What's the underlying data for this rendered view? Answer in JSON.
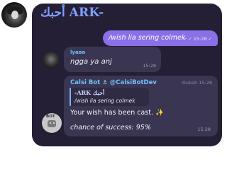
{
  "chat": {
    "title": "أحبك ARK-"
  },
  "messages": {
    "outgoing": {
      "text": "/wish lia sering colmek",
      "meta": "↩ ✓ 15:28 ✓"
    },
    "incoming": {
      "sender": "lyaaa",
      "text": "ngga ya anj",
      "time": "15:28"
    },
    "bot": {
      "sender_name": "Calsi Bot",
      "sender_icon": "anchor-icon",
      "sender_handle": "@CalsiBotDev",
      "edited_label": "diubah 15:28",
      "quote_title": "-ARK أحبك",
      "quote_text": "/wish lia sering colmek",
      "result": "Your wish has been cast.",
      "result_icon": "✨",
      "chance": "chance of success: 95%",
      "time": "15:28",
      "avatar_label": "BOT"
    }
  },
  "colors": {
    "card_bg": "#241f35",
    "outgoing_bubble": "#8b6fe6",
    "incoming_bubble": "#3a3550",
    "sender_name": "#6ec0ff",
    "title": "#7fa0ff"
  }
}
